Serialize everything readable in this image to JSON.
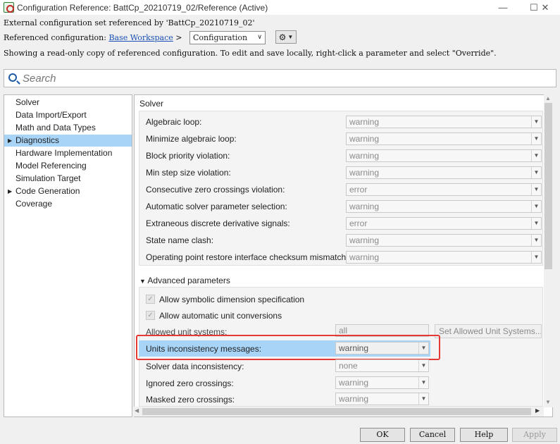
{
  "window": {
    "title": "Configuration Reference: BattCp_20210719_02/Reference (Active)",
    "minimize": "—",
    "maximize": "☐",
    "close": "✕"
  },
  "info": {
    "line1": "External configuration set referenced by 'BattCp_20210719_02'",
    "referenced_label": "Referenced configuration:",
    "workspace_link": "Base Workspace",
    "breadcrumb_sep": ">",
    "config_value": "Configuration",
    "line3": "Showing a read-only copy of referenced configuration. To edit and save locally, right-click a parameter and select \"Override\"."
  },
  "search": {
    "placeholder": "Search"
  },
  "tree": {
    "items": [
      {
        "label": "Solver",
        "expandable": false
      },
      {
        "label": "Data Import/Export",
        "expandable": false
      },
      {
        "label": "Math and Data Types",
        "expandable": false
      },
      {
        "label": "Diagnostics",
        "expandable": true,
        "selected": true
      },
      {
        "label": "Hardware Implementation",
        "expandable": false
      },
      {
        "label": "Model Referencing",
        "expandable": false
      },
      {
        "label": "Simulation Target",
        "expandable": false
      },
      {
        "label": "Code Generation",
        "expandable": true
      },
      {
        "label": "Coverage",
        "expandable": false
      }
    ]
  },
  "panel": {
    "section_title": "Solver",
    "solver_rows": [
      {
        "label": "Algebraic loop:",
        "value": "warning"
      },
      {
        "label": "Minimize algebraic loop:",
        "value": "warning"
      },
      {
        "label": "Block priority violation:",
        "value": "warning"
      },
      {
        "label": "Min step size violation:",
        "value": "warning"
      },
      {
        "label": "Consecutive zero crossings violation:",
        "value": "error"
      },
      {
        "label": "Automatic solver parameter selection:",
        "value": "warning"
      },
      {
        "label": "Extraneous discrete derivative signals:",
        "value": "error"
      },
      {
        "label": "State name clash:",
        "value": "warning"
      },
      {
        "label": "Operating point restore interface checksum mismatch:",
        "value": "warning"
      }
    ],
    "advanced_title": "Advanced parameters",
    "checkboxes": [
      {
        "label": "Allow symbolic dimension specification",
        "checked": true
      },
      {
        "label": "Allow automatic unit conversions",
        "checked": true
      }
    ],
    "allowed_units_label": "Allowed unit systems:",
    "allowed_units_value": "all",
    "set_units_button": "Set Allowed Unit Systems...",
    "advanced_rows": [
      {
        "label": "Units inconsistency messages:",
        "value": "warning"
      },
      {
        "label": "Solver data inconsistency:",
        "value": "none"
      },
      {
        "label": "Ignored zero crossings:",
        "value": "warning"
      },
      {
        "label": "Masked zero crossings:",
        "value": "warning"
      }
    ]
  },
  "buttons": {
    "ok": "OK",
    "cancel": "Cancel",
    "help": "Help",
    "apply": "Apply"
  },
  "colors": {
    "selection": "#a8d4f8",
    "highlight_border": "#e53935",
    "link": "#1a4fb5"
  }
}
